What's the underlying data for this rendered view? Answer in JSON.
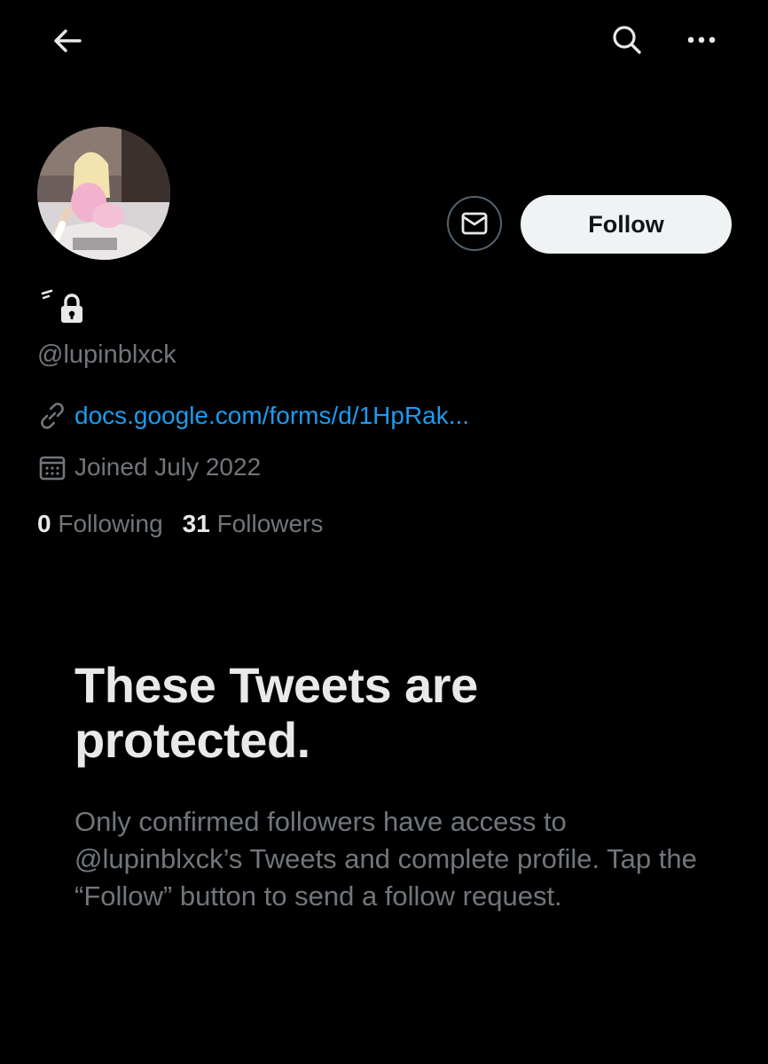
{
  "header": {
    "back_icon": "arrow-left-icon",
    "search_icon": "search-icon",
    "more_icon": "more-horizontal-icon"
  },
  "profile": {
    "display_name": "",
    "protected_icon": "lock-icon",
    "handle": "@lupinblxck",
    "link_icon": "link-icon",
    "link": "docs.google.com/forms/d/1HpRak...",
    "joined_icon": "calendar-icon",
    "joined": "Joined July 2022",
    "following_count": "0",
    "following_label": "Following",
    "followers_count": "31",
    "followers_label": "Followers"
  },
  "actions": {
    "message_icon": "mail-icon",
    "follow_label": "Follow"
  },
  "protected": {
    "title": "These Tweets are protected.",
    "body": "Only confirmed followers have access to @lupinblxck’s Tweets and complete profile. Tap the “Follow” button to send a follow request."
  },
  "colors": {
    "background": "#000000",
    "primary_text": "#e7e9ea",
    "secondary_text": "#71767b",
    "link": "#1d9bf0",
    "follow_button_bg": "#eff3f4"
  }
}
